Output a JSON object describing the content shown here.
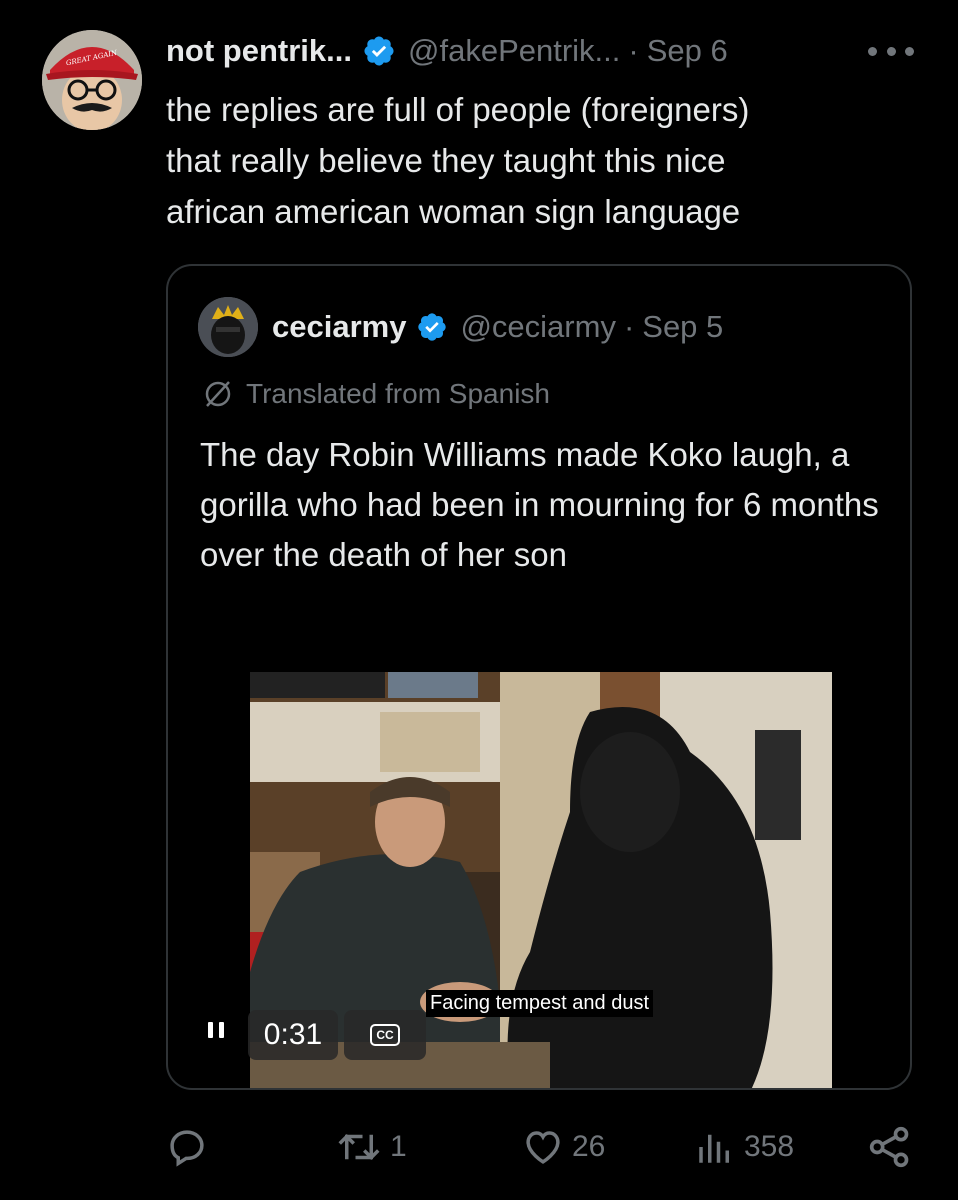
{
  "tweet": {
    "author_name": "not pentrik...",
    "handle": "@fakePentrik...",
    "separator": "·",
    "date": "Sep 6",
    "text": "the replies are full of people (foreigners)\nthat really believe they taught this nice\nafrican american woman sign language",
    "avatar_hat_text": "MAKE AMERICA GREAT AGAIN"
  },
  "quoted": {
    "author_name": "ceciarmy",
    "handle": "@ceciarmy",
    "separator": "·",
    "date": "Sep 5",
    "translated_label": "Translated from Spanish",
    "text": "The day Robin Williams made Koko laugh, a gorilla who had been in mourning for 6 months over the death of her son",
    "video": {
      "caption": "Facing tempest and dust",
      "time": "0:31",
      "cc_label": "CC"
    }
  },
  "actions": {
    "reply_count": "",
    "retweet_count": "1",
    "like_count": "26",
    "views_count": "358"
  },
  "colors": {
    "background": "#000000",
    "text_primary": "#e7e9ea",
    "text_secondary": "#71767b",
    "verified_blue": "#1d9bf0",
    "border": "#2f3336"
  },
  "icons": [
    "verified-badge-icon",
    "more-icon",
    "translate-icon",
    "pause-icon",
    "closed-captions-icon",
    "reply-icon",
    "retweet-icon",
    "like-icon",
    "views-icon",
    "share-icon"
  ]
}
